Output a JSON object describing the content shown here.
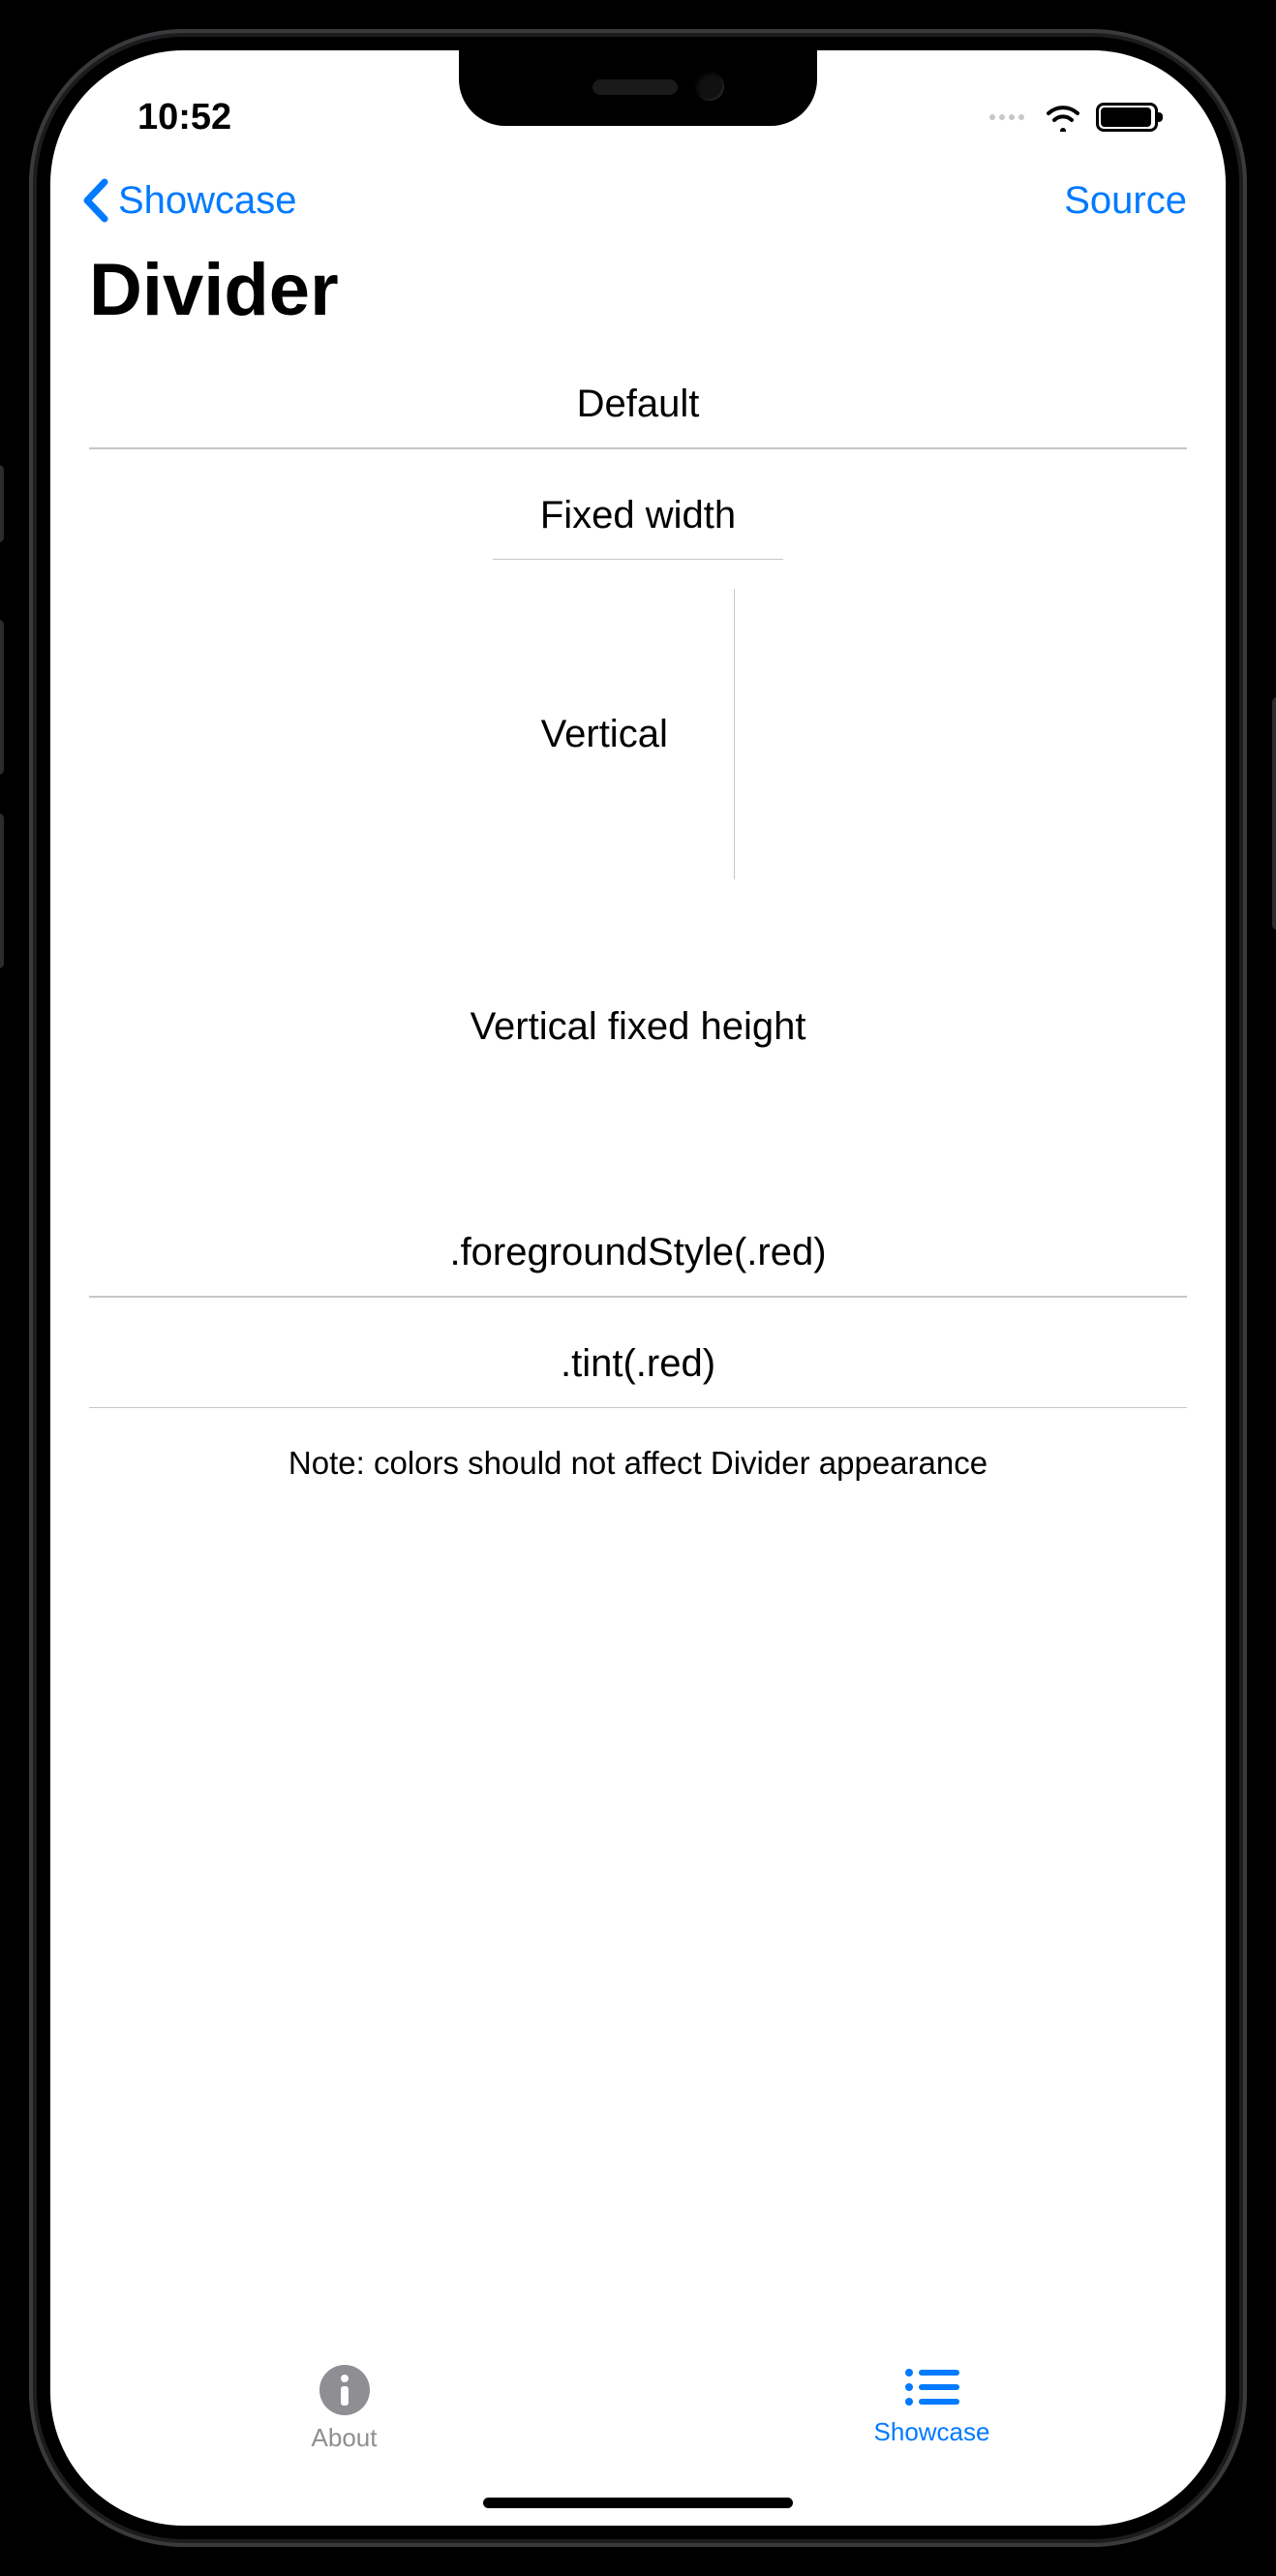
{
  "status": {
    "time": "10:52"
  },
  "nav": {
    "back_label": "Showcase",
    "right_label": "Source"
  },
  "title": "Divider",
  "sections": {
    "default": "Default",
    "fixed_width": "Fixed width",
    "vertical": "Vertical",
    "vertical_fixed": "Vertical fixed height",
    "foreground": ".foregroundStyle(.red)",
    "tint": ".tint(.red)"
  },
  "note": "Note: colors should not affect Divider appearance",
  "tabs": {
    "about": "About",
    "showcase": "Showcase"
  }
}
